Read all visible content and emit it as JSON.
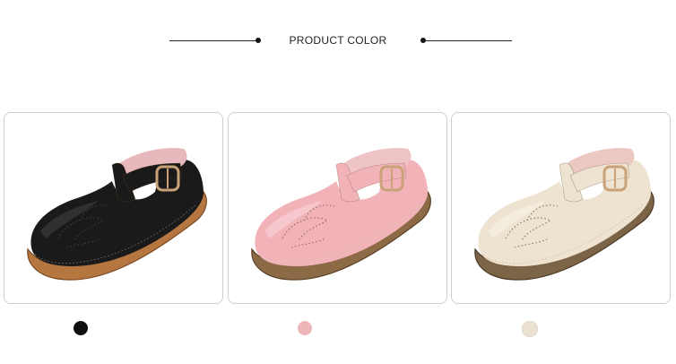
{
  "header": {
    "title": "PRODUCT COLOR"
  },
  "products": [
    {
      "color_name": "black",
      "upper": "#1a1a1a",
      "upper_hi": "#3a3a3a",
      "lining": "#e7b9bd",
      "sole": "#b6763f",
      "sole_dark": "#7a4a24",
      "swatch": "#0f0f0f"
    },
    {
      "color_name": "pink",
      "upper": "#f2b3b8",
      "upper_hi": "#f8d2d5",
      "lining": "#efc4c7",
      "sole": "#8c6a45",
      "sole_dark": "#5a4128",
      "swatch": "#efb6ba"
    },
    {
      "color_name": "beige",
      "upper": "#eee3d0",
      "upper_hi": "#f7f1e6",
      "lining": "#ecc8c3",
      "sole": "#7c6446",
      "sole_dark": "#4c3a26",
      "swatch": "#ece2d2"
    }
  ]
}
